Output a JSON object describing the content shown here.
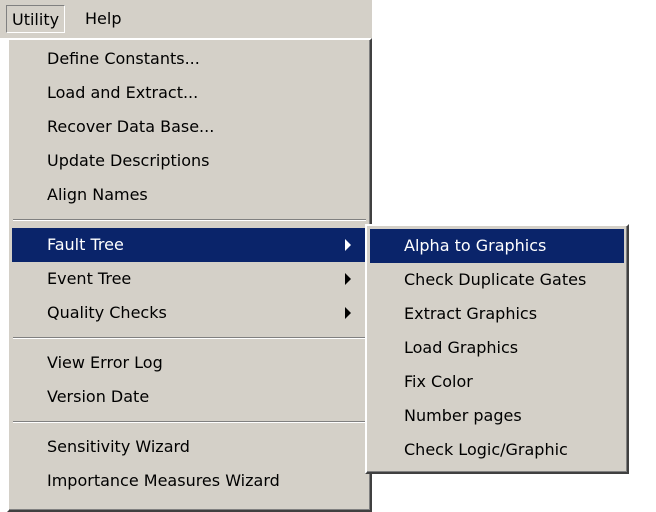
{
  "menubar": {
    "items": [
      {
        "label": "Utility"
      },
      {
        "label": "Help"
      }
    ]
  },
  "utility_menu": {
    "items": [
      {
        "label": "Define Constants..."
      },
      {
        "label": "Load and Extract..."
      },
      {
        "label": "Recover Data Base..."
      },
      {
        "label": "Update Descriptions"
      },
      {
        "label": "Align Names"
      },
      {
        "label": "Fault Tree"
      },
      {
        "label": "Event Tree"
      },
      {
        "label": "Quality Checks"
      },
      {
        "label": "View Error Log"
      },
      {
        "label": "Version Date"
      },
      {
        "label": "Sensitivity Wizard"
      },
      {
        "label": "Importance Measures Wizard"
      }
    ]
  },
  "fault_tree_submenu": {
    "items": [
      {
        "label": "Alpha to Graphics"
      },
      {
        "label": "Check Duplicate Gates"
      },
      {
        "label": "Extract Graphics"
      },
      {
        "label": "Load Graphics"
      },
      {
        "label": "Fix Color"
      },
      {
        "label": "Number pages"
      },
      {
        "label": "Check Logic/Graphic"
      }
    ]
  },
  "colors": {
    "menu_background": "#d4d0c8",
    "highlight_background": "#0a246a",
    "highlight_text": "#ffffff"
  }
}
